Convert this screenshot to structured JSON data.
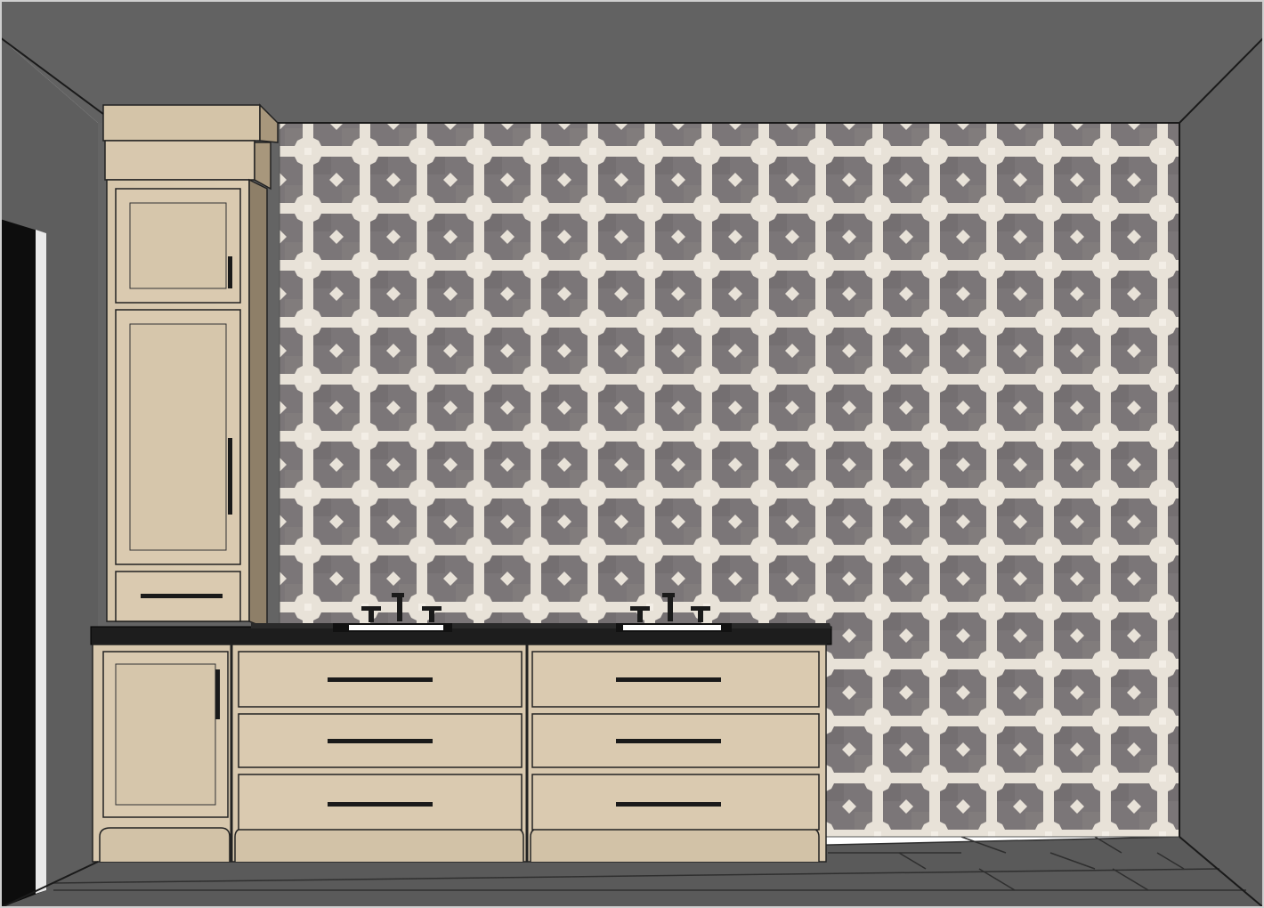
{
  "palette": {
    "wall": "#5f5f5f",
    "ceiling": "#626262",
    "floor": "#5c5c5c",
    "tile_dark": "#7a7577",
    "tile_dark_alt": "#8a8587",
    "tile_light": "#e8e2d8",
    "wood": "#d8c8ae",
    "wood_shadow": "#bda98c",
    "countertop": "#1e1e1e",
    "hardware": "#1a1a1a",
    "sink": "#ffffff"
  },
  "icons": {
    "faucet_left": "faucet-icon",
    "faucet_right": "faucet-icon"
  }
}
